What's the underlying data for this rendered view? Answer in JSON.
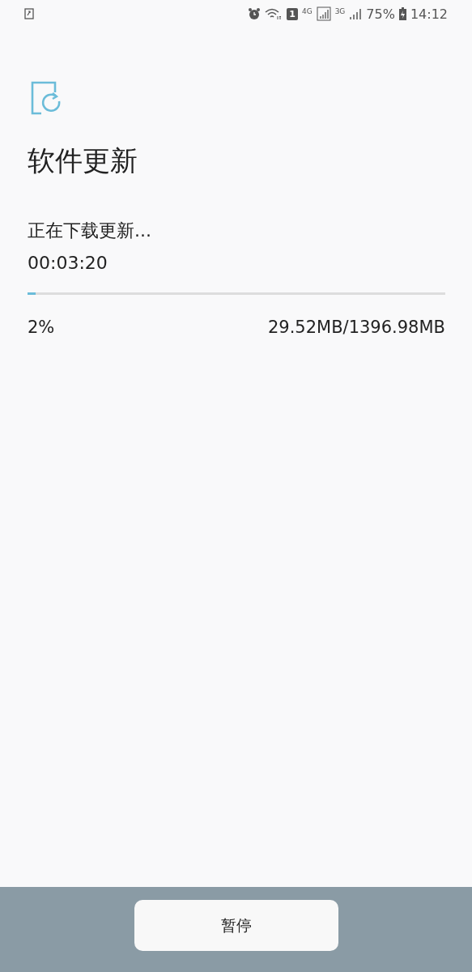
{
  "status_bar": {
    "sim_badge": "1",
    "network_1": "4G",
    "network_2": "3G",
    "battery": "75%",
    "time": "14:12"
  },
  "title": "软件更新",
  "status_text": "正在下载更新...",
  "elapsed": "00:03:20",
  "progress": {
    "level": 0.02,
    "percent": "2%",
    "size": "29.52MB/1396.98MB"
  },
  "buttons": [
    {
      "label": "暂停"
    }
  ]
}
